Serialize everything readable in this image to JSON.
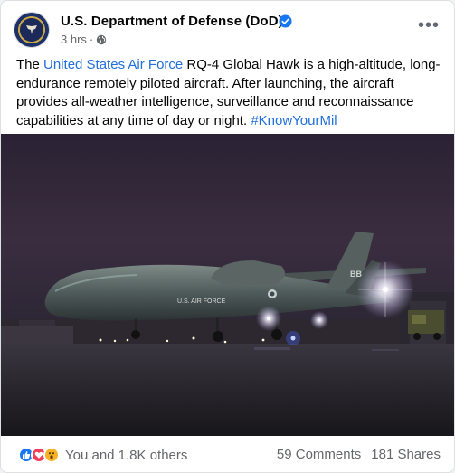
{
  "post": {
    "page_name": "U.S. Department of Defense (DoD)",
    "time": "3 hrs",
    "separator": "·",
    "text_pre": "The ",
    "text_link": "United States Air Force",
    "text_body": " RQ-4 Global Hawk is a high-altitude, long-endurance remotely piloted aircraft. After launching, the aircraft provides all-weather intelligence, surveillance and reconnaissance capabilities at any time of day or night. ",
    "hashtag": "#KnowYourMil"
  },
  "photo": {
    "fuselage_marking": "U.S. AIR FORCE",
    "tail_code": "BB"
  },
  "footer": {
    "reaction_summary": "You and 1.8K others",
    "comments": "59 Comments",
    "shares": "181 Shares"
  },
  "icons": {
    "verified": "verified-badge-icon",
    "audience": "globe-icon",
    "more": "more-options-icon",
    "reactions": [
      "like-reaction-icon",
      "love-reaction-icon",
      "wow-reaction-icon"
    ]
  },
  "colors": {
    "link": "#216fdb",
    "verified": "#1877f2",
    "secondary_text": "#65676b"
  }
}
